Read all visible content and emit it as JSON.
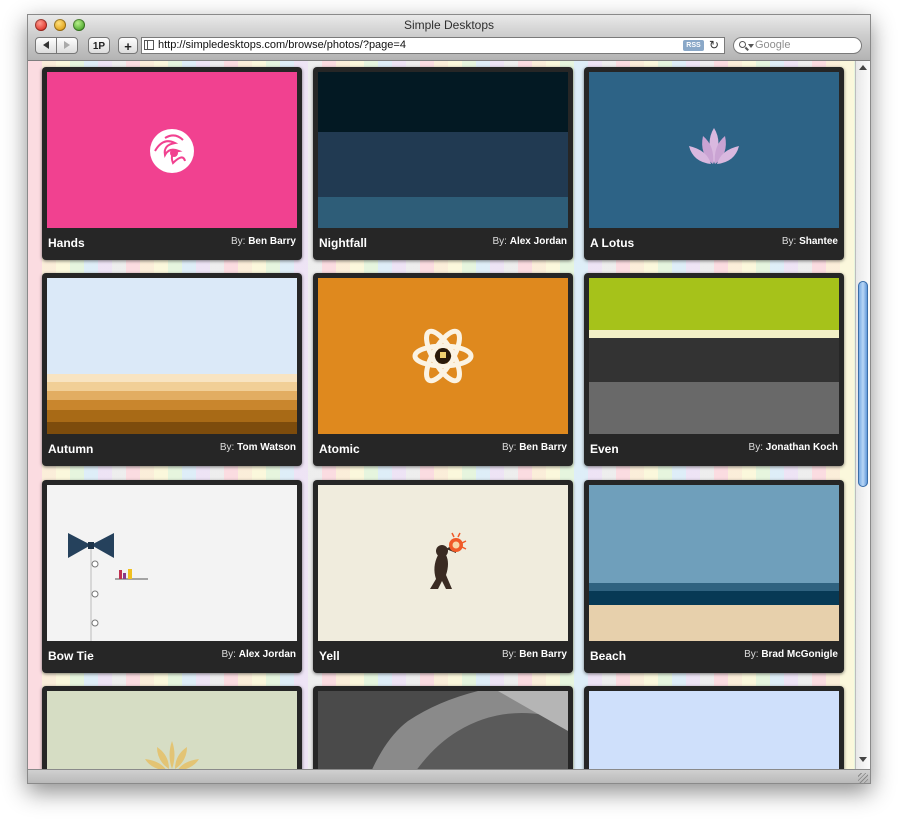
{
  "window": {
    "title": "Simple Desktops"
  },
  "toolbar": {
    "onepassword_label": "1P",
    "add_bookmark_label": "+",
    "url": "http://simpledesktops.com/browse/photos/?page=4",
    "rss_label": "RSS",
    "search_placeholder": "Google"
  },
  "by_prefix": "By:",
  "cards": [
    {
      "title": "Hands",
      "author": "Ben Barry",
      "icon": "crane-emblem-icon"
    },
    {
      "title": "Nightfall",
      "author": "Alex Jordan",
      "icon": "horizontal-bands"
    },
    {
      "title": "A Lotus",
      "author": "Shantee",
      "icon": "lotus-icon"
    },
    {
      "title": "Autumn",
      "author": "Tom Watson",
      "icon": "layered-stripes"
    },
    {
      "title": "Atomic",
      "author": "Ben Barry",
      "icon": "atom-icon"
    },
    {
      "title": "Even",
      "author": "Jonathan Koch",
      "icon": "horizontal-bands"
    },
    {
      "title": "Bow Tie",
      "author": "Alex Jordan",
      "icon": "bow-tie-icon"
    },
    {
      "title": "Yell",
      "author": "Ben Barry",
      "icon": "yelling-man-icon"
    },
    {
      "title": "Beach",
      "author": "Brad McGonigle",
      "icon": "horizontal-bands"
    }
  ],
  "colors": {
    "hands_bg": "#f14190",
    "nightfall_bands": [
      "#031923",
      "#213a52",
      "#2e5d78"
    ],
    "lotus_bg": "#2d6386",
    "autumn_sky": "#dbe9f8",
    "atomic_bg": "#df891e",
    "even_bands": [
      "#a6c21a",
      "#f2f0c6",
      "#333333",
      "#696969"
    ],
    "bowtie_bg": "#f3f3f3",
    "yell_bg": "#f0ecdd",
    "beach_bands": [
      "#6f9fbb",
      "#2f6280",
      "#073955",
      "#e7d0ac"
    ]
  }
}
